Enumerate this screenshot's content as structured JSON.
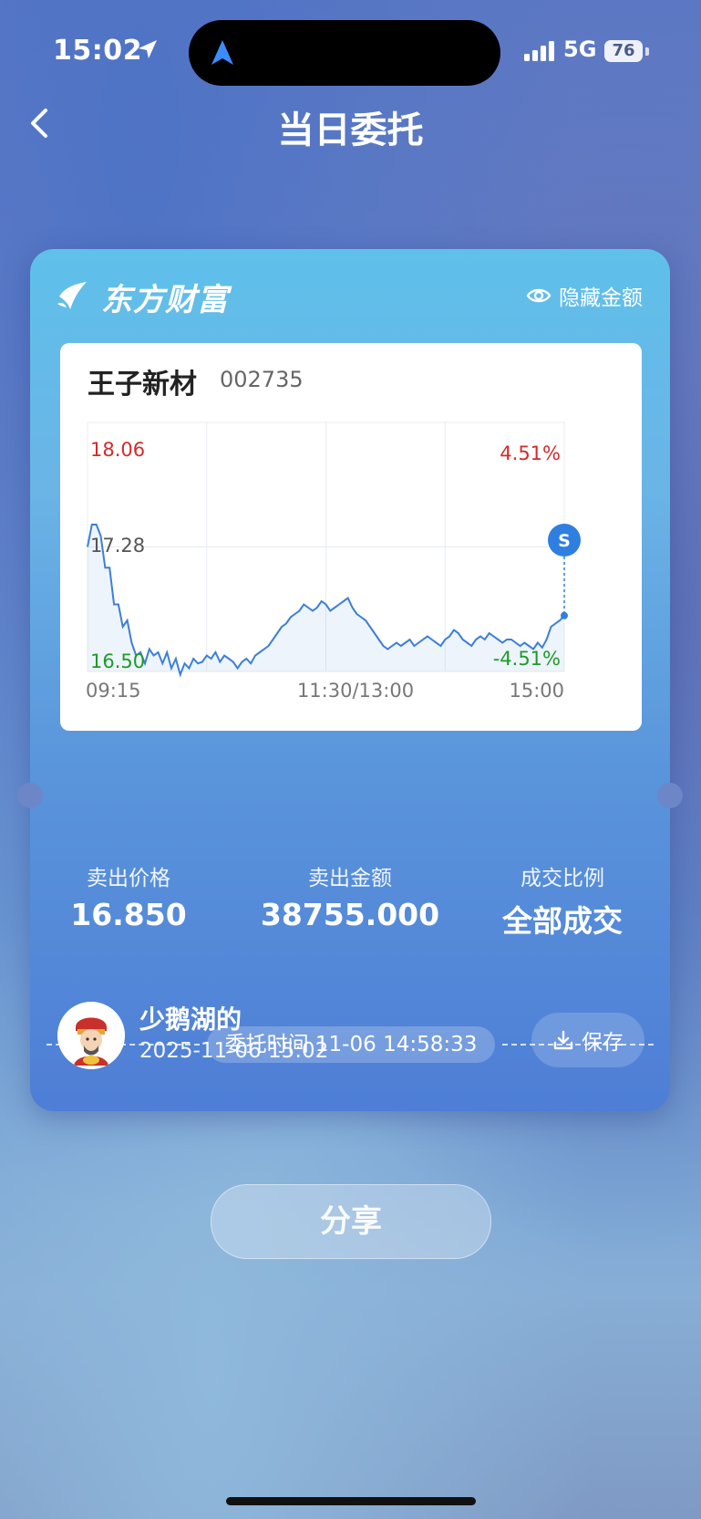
{
  "status_bar": {
    "time": "15:02",
    "network": "5G",
    "battery": "76"
  },
  "header": {
    "title": "当日委托"
  },
  "card": {
    "brand": "东方财富",
    "hide_amount_label": "隐藏金额",
    "stock": {
      "name": "王子新材",
      "code": "002735"
    },
    "order_time_label": "委托时间 11-06 14:58:33",
    "stats": [
      {
        "label": "卖出价格",
        "value": "16.850"
      },
      {
        "label": "卖出金额",
        "value": "38755.000"
      },
      {
        "label": "成交比例",
        "value": "全部成交"
      }
    ],
    "user": {
      "name": "少鹅湖的",
      "time": "2025-11-06 15:02"
    },
    "save_label": "保存"
  },
  "share_label": "分享",
  "chart_data": {
    "type": "line",
    "y_labels": {
      "top": "18.06",
      "mid": "17.28",
      "bottom": "16.50"
    },
    "pct_labels": {
      "top": "4.51%",
      "bottom": "-4.51%"
    },
    "x_labels": [
      "09:15",
      "11:30/13:00",
      "15:00"
    ],
    "ylim": [
      16.5,
      18.06
    ],
    "marker_label": "S",
    "marker_price": 16.85,
    "colors": {
      "line": "#3d7fd6",
      "up": "#d22b2b",
      "down": "#1e9a2a",
      "marker": "#2e7fe0"
    },
    "prices": [
      17.28,
      17.42,
      17.42,
      17.35,
      17.15,
      17.15,
      16.92,
      16.92,
      16.78,
      16.82,
      16.68,
      16.6,
      16.62,
      16.55,
      16.64,
      16.6,
      16.62,
      16.55,
      16.62,
      16.52,
      16.58,
      16.48,
      16.55,
      16.52,
      16.58,
      16.55,
      16.56,
      16.6,
      16.58,
      16.62,
      16.56,
      16.6,
      16.58,
      16.56,
      16.52,
      16.56,
      16.58,
      16.55,
      16.6,
      16.62,
      16.64,
      16.66,
      16.7,
      16.74,
      16.78,
      16.8,
      16.84,
      16.86,
      16.88,
      16.92,
      16.9,
      16.88,
      16.9,
      16.94,
      16.92,
      16.88,
      16.9,
      16.92,
      16.94,
      16.96,
      16.9,
      16.86,
      16.84,
      16.82,
      16.78,
      16.74,
      16.7,
      16.66,
      16.64,
      16.66,
      16.68,
      16.66,
      16.68,
      16.7,
      16.66,
      16.68,
      16.7,
      16.72,
      16.7,
      16.68,
      16.66,
      16.7,
      16.72,
      16.76,
      16.74,
      16.7,
      16.68,
      16.66,
      16.7,
      16.72,
      16.7,
      16.74,
      16.72,
      16.7,
      16.68,
      16.7,
      16.7,
      16.68,
      16.66,
      16.68,
      16.66,
      16.64,
      16.68,
      16.65,
      16.7,
      16.78,
      16.8,
      16.82,
      16.85
    ]
  }
}
